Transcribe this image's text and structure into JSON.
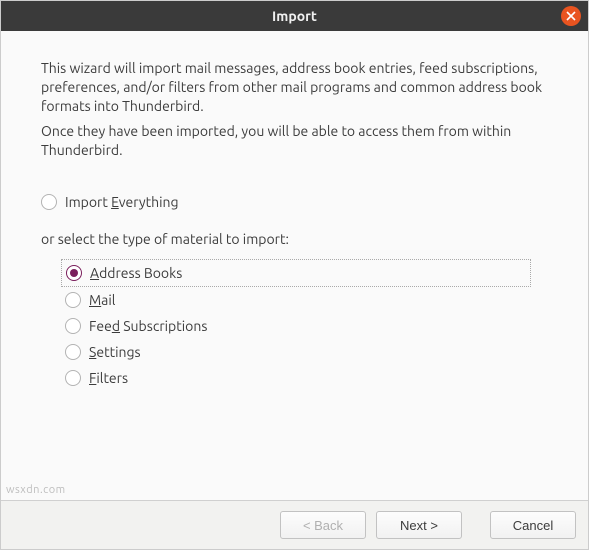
{
  "titlebar": {
    "title": "Import"
  },
  "intro": {
    "p1": "This wizard will import mail messages, address book entries, feed subscriptions, preferences, and/or filters from other mail programs and common address book formats into Thunderbird.",
    "p2": "Once they have been imported, you will be able to access them from within Thunderbird."
  },
  "radios": {
    "everything_pre": "Import ",
    "everything_u": "E",
    "everything_post": "verything",
    "subhead": "or select the type of material to import:",
    "address_u": "A",
    "address_post": "ddress Books",
    "mail_u": "M",
    "mail_post": "ail",
    "feed_pre": "Fee",
    "feed_u": "d",
    "feed_post": " Subscriptions",
    "settings_u": "S",
    "settings_post": "ettings",
    "filters_u": "F",
    "filters_post": "ilters"
  },
  "buttons": {
    "back": "< Back",
    "next": "Next >",
    "cancel": "Cancel"
  },
  "watermark": "wsxdn.com"
}
